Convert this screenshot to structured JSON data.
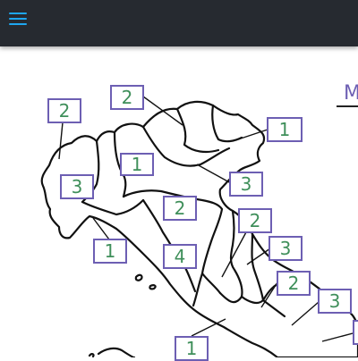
{
  "app": {
    "menu_icon": "hamburger-menu-icon",
    "accent_color": "#1ea7f0",
    "topbar_color": "#262a30"
  },
  "map": {
    "description_hidden": "",
    "legend_letter": "M",
    "label_color": "#3f8f5a",
    "box_color": "#6d5fb3",
    "labels": [
      {
        "id": "valle-aosta",
        "value": "2"
      },
      {
        "id": "trentino",
        "value": "2"
      },
      {
        "id": "lombardia",
        "value": "1"
      },
      {
        "id": "friuli",
        "value": "1"
      },
      {
        "id": "piemonte",
        "value": "3"
      },
      {
        "id": "veneto",
        "value": "3"
      },
      {
        "id": "emilia",
        "value": "2"
      },
      {
        "id": "liguria",
        "value": "1"
      },
      {
        "id": "marche",
        "value": "2"
      },
      {
        "id": "umbria",
        "value": "3"
      },
      {
        "id": "toscana",
        "value": "4"
      },
      {
        "id": "abruzzo",
        "value": "2"
      },
      {
        "id": "molise",
        "value": "3"
      },
      {
        "id": "lazio",
        "value": "1"
      }
    ]
  }
}
